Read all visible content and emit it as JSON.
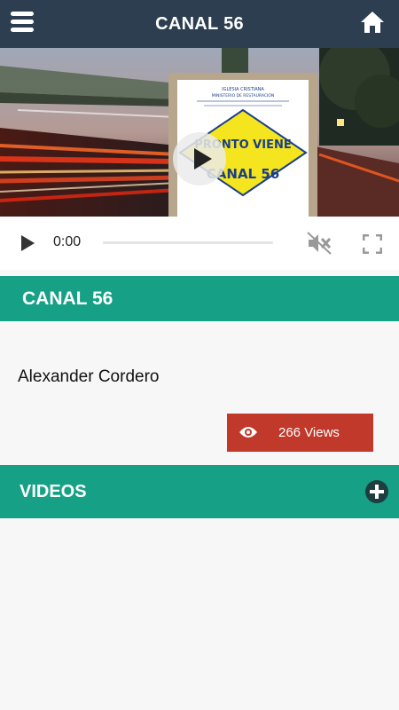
{
  "header": {
    "title": "CANAL 56",
    "menu_icon": "hamburger-menu-icon",
    "home_icon": "home-icon",
    "background": "#2c3e50"
  },
  "video": {
    "poster": {
      "sign_line1": "IGLESIA CRISTIANA",
      "sign_line2": "MINISTERIO DE RESTAURACION",
      "banner_top": "PRONTO VIENE",
      "banner_bottom": "CANAL 56"
    },
    "player": {
      "current_time": "0:00",
      "progress": 0,
      "muted": true
    }
  },
  "channel": {
    "title": "CANAL 56",
    "author": "Alexander Cordero",
    "views_label": "266 Views",
    "accent": "#16a085",
    "views_color": "#c0392b"
  },
  "videos_section": {
    "title": "VIDEOS",
    "add_icon": "plus-circle-icon"
  }
}
